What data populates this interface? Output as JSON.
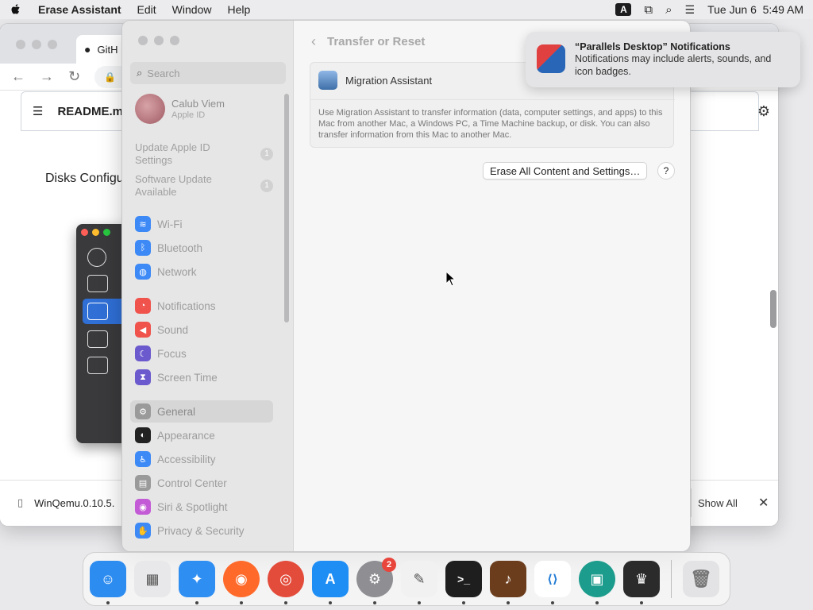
{
  "menubar": {
    "app_name": "Erase Assistant",
    "items": [
      "Edit",
      "Window",
      "Help"
    ],
    "input_source": "A",
    "datetime": "Tue Jun 6  5:49 AM"
  },
  "browser": {
    "tab_title": "GitH",
    "address": "gi",
    "readme": "README.md",
    "heading": "Disks Configu",
    "download_file": "WinQemu.0.10.5.",
    "show_all": "Show All"
  },
  "settings": {
    "search_placeholder": "Search",
    "user": {
      "name": "Calub Viem",
      "sub": "Apple ID"
    },
    "updates": [
      {
        "label": "Update Apple ID Settings",
        "count": "1"
      },
      {
        "label": "Software Update Available",
        "count": "1"
      }
    ],
    "sidebar_groups": [
      [
        {
          "label": "Wi-Fi",
          "icon": "wifi-icon",
          "color": "#3d8af7"
        },
        {
          "label": "Bluetooth",
          "icon": "bluetooth-icon",
          "color": "#3d8af7"
        },
        {
          "label": "Network",
          "icon": "globe-icon",
          "color": "#3d8af7"
        }
      ],
      [
        {
          "label": "Notifications",
          "icon": "bell-icon",
          "color": "#f0524c"
        },
        {
          "label": "Sound",
          "icon": "speaker-icon",
          "color": "#f0524c"
        },
        {
          "label": "Focus",
          "icon": "moon-icon",
          "color": "#6a5acd"
        },
        {
          "label": "Screen Time",
          "icon": "hourglass-icon",
          "color": "#6a5acd"
        }
      ],
      [
        {
          "label": "General",
          "icon": "gear-icon",
          "color": "#9a9a9a",
          "selected": true
        },
        {
          "label": "Appearance",
          "icon": "appearance-icon",
          "color": "#222222"
        },
        {
          "label": "Accessibility",
          "icon": "accessibility-icon",
          "color": "#3d8af7"
        },
        {
          "label": "Control Center",
          "icon": "control-center-icon",
          "color": "#9a9a9a"
        },
        {
          "label": "Siri & Spotlight",
          "icon": "siri-icon",
          "color": "#c45bd6"
        },
        {
          "label": "Privacy & Security",
          "icon": "hand-icon",
          "color": "#3d8af7"
        }
      ]
    ],
    "breadcrumb": "Transfer or Reset",
    "migration": {
      "title": "Migration Assistant",
      "description": "Use Migration Assistant to transfer information (data, computer settings, and apps) to this Mac from another Mac, a Windows PC, a Time Machine backup, or disk. You can also transfer information from this Mac to another Mac."
    },
    "erase_button": "Erase All Content and Settings…",
    "help_button": "?"
  },
  "notification": {
    "title": "“Parallels Desktop” Notifications",
    "body": "Notifications may include alerts, sounds, and icon badges."
  },
  "dock": [
    {
      "name": "finder",
      "color": "#2d8cf0",
      "glyph": "☺",
      "running": true
    },
    {
      "name": "launchpad",
      "color": "#e8e8ea",
      "glyph": "▦",
      "running": false
    },
    {
      "name": "safari",
      "color": "#2f8ef2",
      "glyph": "✦",
      "running": true
    },
    {
      "name": "firefox",
      "color": "#ff6a2b",
      "glyph": "◉",
      "running": true
    },
    {
      "name": "chrome",
      "color": "#e34b3a",
      "glyph": "◎",
      "running": true
    },
    {
      "name": "app-store",
      "color": "#1e8ef5",
      "glyph": "A",
      "running": true
    },
    {
      "name": "system-settings",
      "color": "#8e8e93",
      "glyph": "⚙",
      "running": true,
      "badge": "2"
    },
    {
      "name": "textedit",
      "color": "#f1f1f1",
      "glyph": "✎",
      "running": true
    },
    {
      "name": "terminal",
      "color": "#1e1e1e",
      "glyph": ">_",
      "running": true
    },
    {
      "name": "garageband",
      "color": "#6b3d1c",
      "glyph": "♪",
      "running": true
    },
    {
      "name": "vscode",
      "color": "#ffffff",
      "glyph": "⟨⟩",
      "running": true
    },
    {
      "name": "green-app",
      "color": "#1c9c8c",
      "glyph": "▣",
      "running": true
    },
    {
      "name": "tuxedo-app",
      "color": "#2b2b2b",
      "glyph": "♛",
      "running": true
    },
    {
      "name": "trash",
      "color": "#e3e3e6",
      "glyph": "🗑",
      "running": false
    }
  ]
}
